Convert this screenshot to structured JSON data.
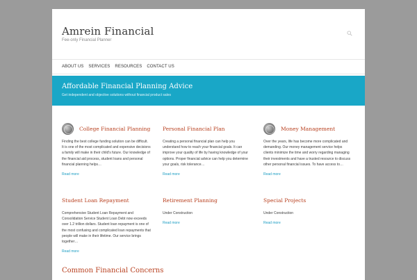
{
  "site": {
    "title": "Amrein Financial",
    "tagline": "Fee-only Financial Planner"
  },
  "nav": {
    "items": [
      {
        "label": "ABOUT US"
      },
      {
        "label": "SERVICES"
      },
      {
        "label": "RESOURCES"
      },
      {
        "label": "CONTACT US"
      }
    ]
  },
  "banner": {
    "title": "Affordable Financial Planning Advice",
    "subtitle": "Get independent and objective solutions without financial product sales"
  },
  "cards": [
    {
      "title": "College Financial Planning",
      "icon": "college-thumbnail-icon",
      "body": "Finding the best college funding solution can be difficult.  It is one of the most complicated and expensive decisions a family will make in their child's future. Our knowledge of the financial aid process, student loans and personal financial planning helps…",
      "more": "Read more"
    },
    {
      "title": "Personal Financial Plan",
      "body": "Creating a personal financial plan can help you understand how to reach your financial goals.  It can improve your quality of life by having knowledge of your options.   Proper financial advice can help you determine your goals, risk tolerance…",
      "more": "Read more"
    },
    {
      "title": "Money Management",
      "icon": "money-thumbnail-icon",
      "body": "Over the years, life has become more complicated and demanding.  Our money management service helps clients minimize the time and worry regarding managing their investments and have a trusted resource to discuss other personal financial issues.  To have access to…",
      "more": "Read more"
    },
    {
      "title": "Student Loan Repayment",
      "body": "Comprehensive Student Loan Repayment and Consolidation Service Student Loan Debt now exceeds over 1.2 trillion dollars. Student loan repayment is one of the most confusing and complicated loan repayments that people will make in their lifetime.  Our service brings together…",
      "more": "Read more"
    },
    {
      "title": "Retirement Planning",
      "body": "Under Construction",
      "more": "Read more"
    },
    {
      "title": "Special Projects",
      "body": "Under Construction",
      "more": "Read more"
    }
  ],
  "section": {
    "title": "Common Financial Concerns"
  },
  "colors": {
    "banner": "#19a7c7",
    "card_title": "#b8401f",
    "link": "#1a9cc2",
    "backdrop": "#9b9b9b"
  }
}
